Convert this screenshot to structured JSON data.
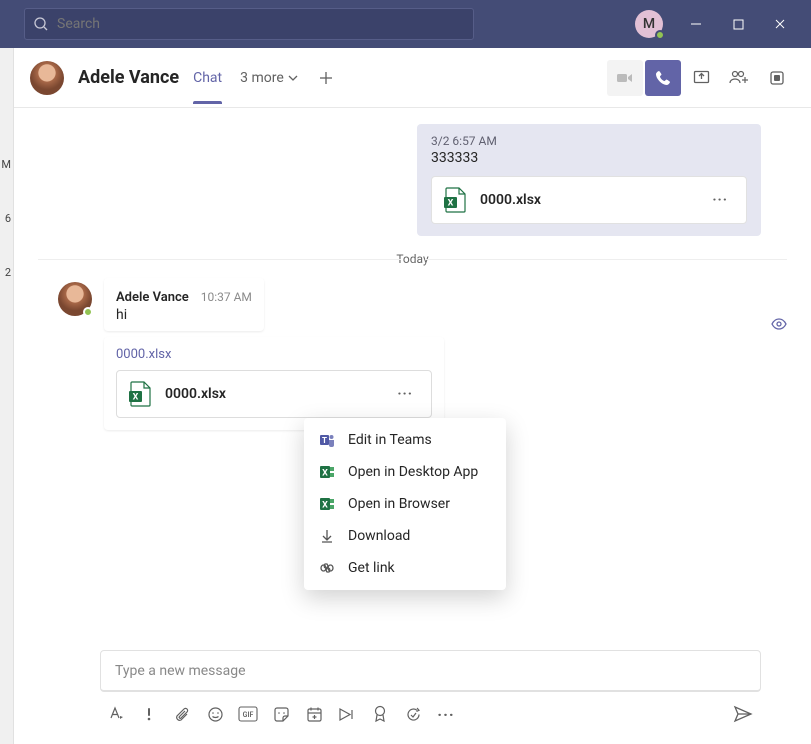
{
  "titlebar": {
    "search_placeholder": "Search",
    "user_initial": "M"
  },
  "leftrail": {
    "badges": [
      "M",
      "6",
      "2"
    ]
  },
  "header": {
    "name": "Adele Vance",
    "tab_chat": "Chat",
    "more_label": "3 more"
  },
  "messages": {
    "outgoing": {
      "timestamp": "3/2 6:57 AM",
      "text": "333333",
      "attachment_name": "0000.xlsx"
    },
    "separator": "Today",
    "incoming": {
      "sender": "Adele Vance",
      "timestamp": "10:37 AM",
      "text": "hi",
      "quote_link": "0000.xlsx",
      "attachment_name": "0000.xlsx"
    }
  },
  "context_menu": {
    "items": [
      {
        "label": "Edit in Teams",
        "icon": "teams"
      },
      {
        "label": "Open in Desktop App",
        "icon": "excel"
      },
      {
        "label": "Open in Browser",
        "icon": "excel"
      },
      {
        "label": "Download",
        "icon": "download"
      },
      {
        "label": "Get link",
        "icon": "link"
      }
    ]
  },
  "compose": {
    "placeholder": "Type a new message"
  }
}
